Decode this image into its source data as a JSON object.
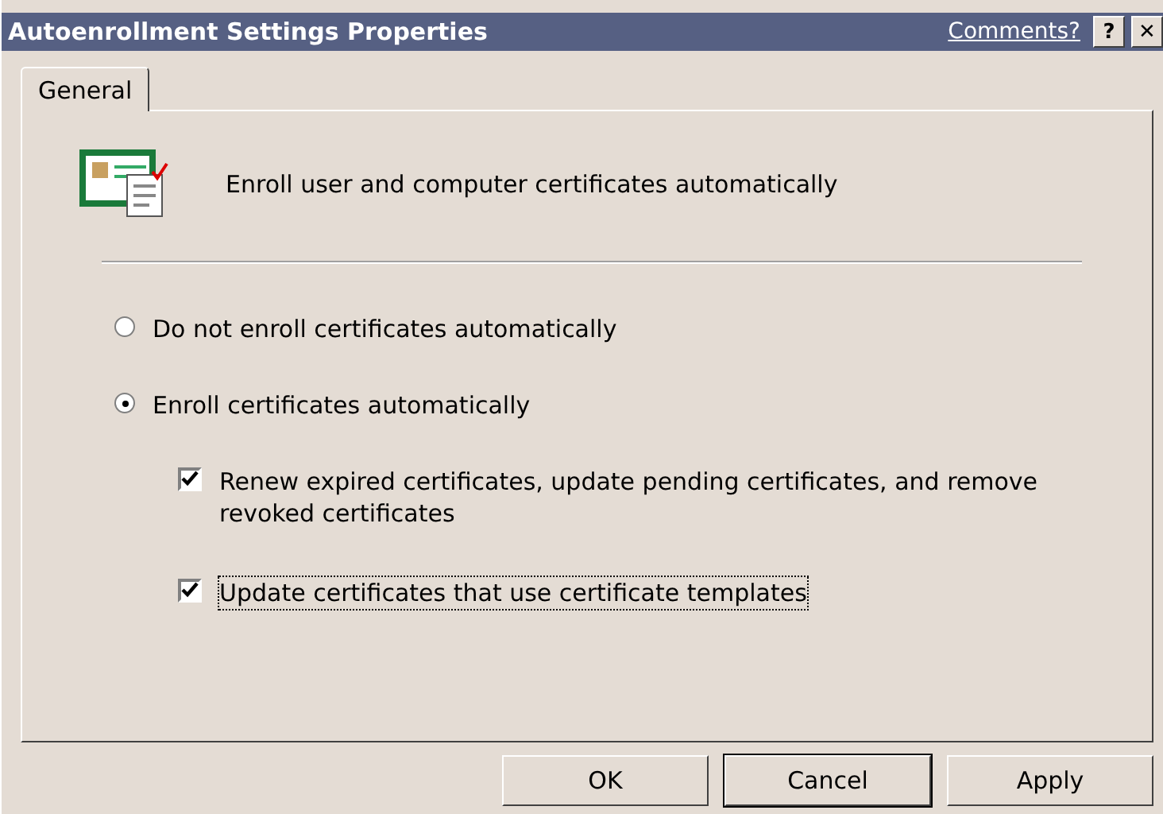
{
  "window": {
    "title": "Autoenrollment Settings Properties",
    "comments_link": "Comments?",
    "help_button": "?",
    "close_button": "✕"
  },
  "tabs": [
    {
      "label": "General",
      "selected": true
    }
  ],
  "header": {
    "text": "Enroll user and computer certificates automatically"
  },
  "options": [
    {
      "kind": "radio",
      "label": "Do not enroll certificates automatically",
      "selected": false,
      "focused": false
    },
    {
      "kind": "radio",
      "label": "Enroll certificates automatically",
      "selected": true,
      "focused": false
    },
    {
      "kind": "checkbox",
      "label": "Renew expired certificates, update pending certificates, and remove revoked certificates",
      "checked": true,
      "focused": false
    },
    {
      "kind": "checkbox",
      "label": "Update certificates that use certificate templates",
      "checked": true,
      "focused": true
    }
  ],
  "buttons": [
    {
      "label": "OK",
      "default": false
    },
    {
      "label": "Cancel",
      "default": true
    },
    {
      "label": "Apply",
      "default": false
    }
  ]
}
